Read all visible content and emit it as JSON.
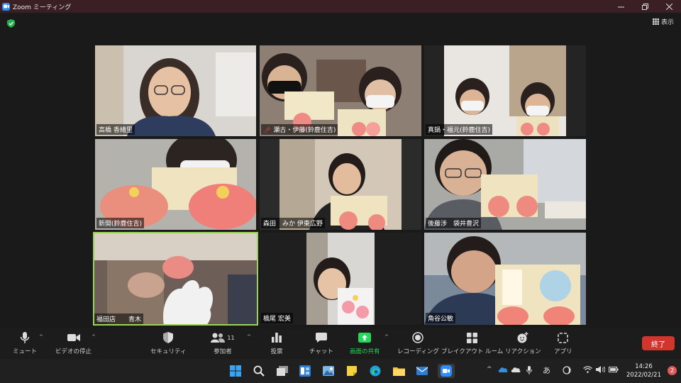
{
  "window": {
    "title": "Zoom ミーティング"
  },
  "view_button": {
    "label": "表示"
  },
  "participants": [
    {
      "name": "高橋 香緒里"
    },
    {
      "name": "瀬古・伊藤(鈴鹿住吉)"
    },
    {
      "name": "真鍋・福元(鈴鹿住吉)"
    },
    {
      "name": "新開(鈴鹿住吉)"
    },
    {
      "name": "森田　みか 伊東広野"
    },
    {
      "name": "後藤涉　袋井豊沢"
    },
    {
      "name": "福田店　　青木"
    },
    {
      "name": "橋尾 宏美"
    },
    {
      "name": "角谷公敏"
    }
  ],
  "toolbar": {
    "mute": "ミュート",
    "stop_video": "ビデオの停止",
    "security": "セキュリティ",
    "participants": "参加者",
    "participants_count": "11",
    "polls": "投票",
    "chat": "チャット",
    "share": "画面の共有",
    "record": "レコーディング",
    "breakout": "ブレイクアウト ルーム",
    "reactions": "リアクション",
    "apps": "アプリ",
    "end": "終了"
  },
  "taskbar": {
    "ime": "あ",
    "time": "14:26",
    "date": "2022/02/21",
    "notifications": "2"
  },
  "colors": {
    "share_green": "#23d959",
    "end_red": "#d1352b",
    "active_speaker": "#9bd35a"
  }
}
